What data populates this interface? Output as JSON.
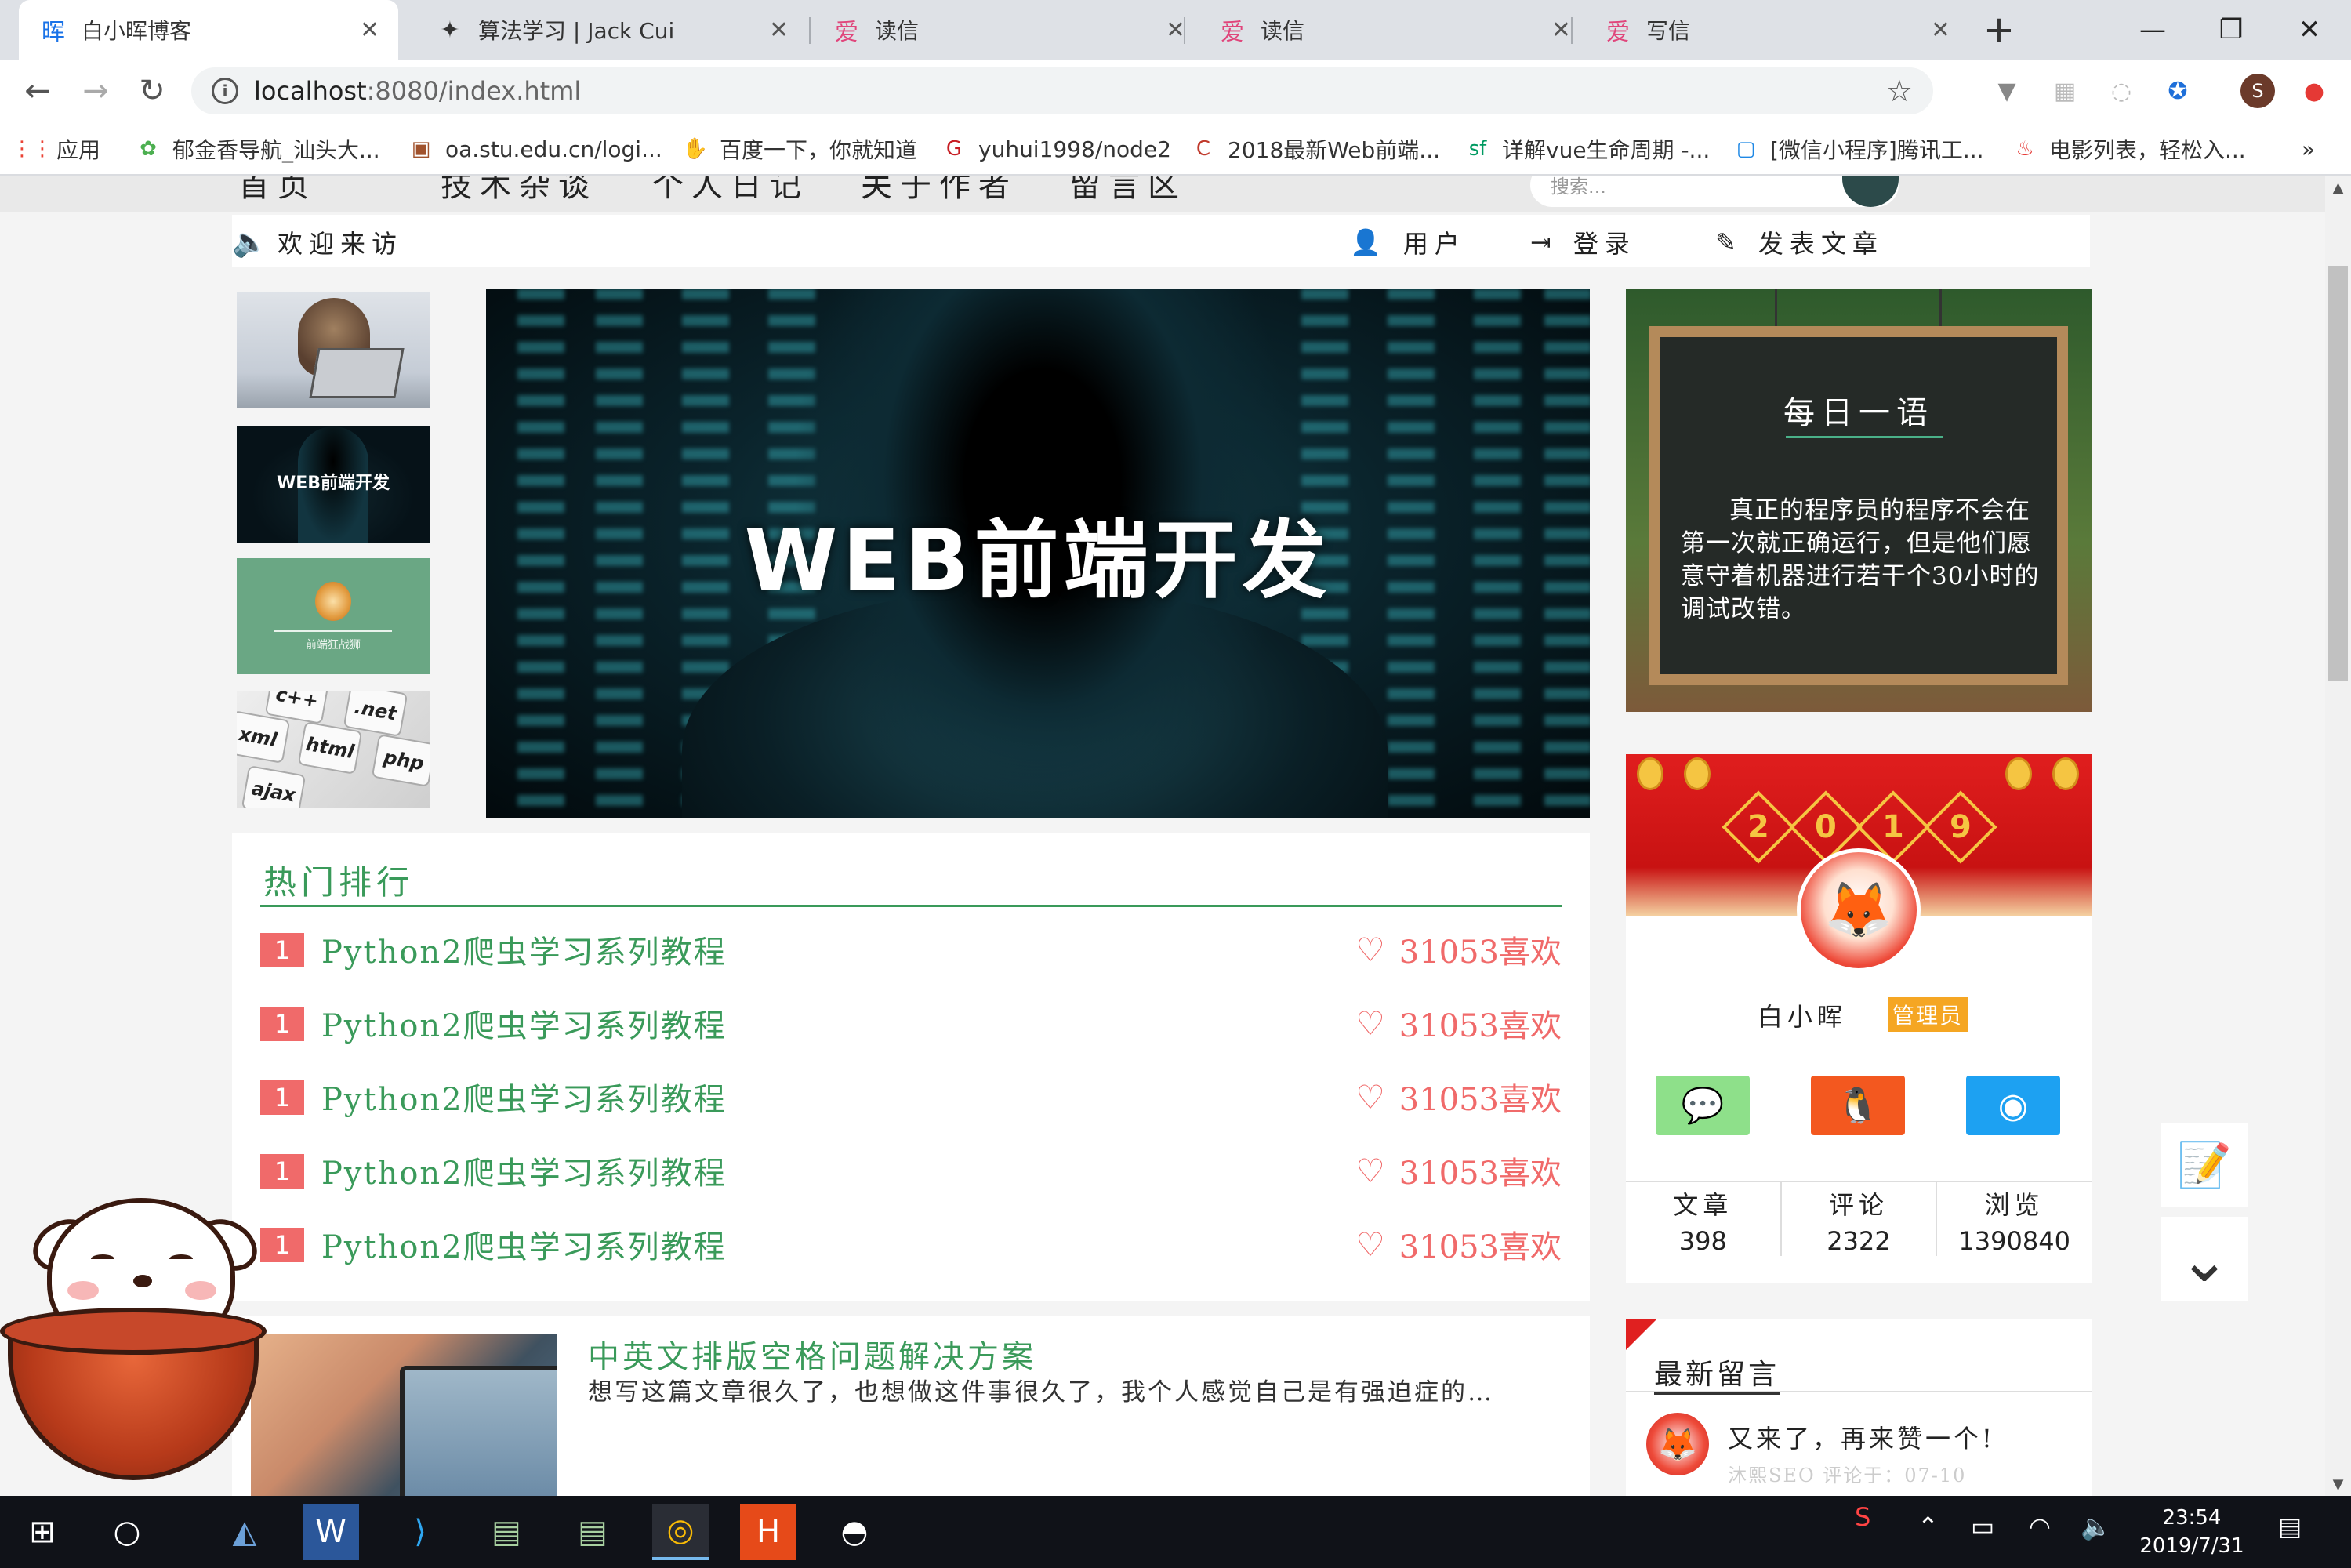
{
  "browser": {
    "tabs": [
      {
        "title": "白小晖博客",
        "favicon": "晖",
        "favicon_color": "#1a73e8",
        "active": true
      },
      {
        "title": "算法学习 | Jack Cui",
        "favicon": "✦",
        "favicon_color": "#333333",
        "active": false
      },
      {
        "title": "读信",
        "favicon": "爱",
        "favicon_color": "#e0457b",
        "active": false
      },
      {
        "title": "读信",
        "favicon": "爱",
        "favicon_color": "#e0457b",
        "active": false
      },
      {
        "title": "写信",
        "favicon": "爱",
        "favicon_color": "#e0457b",
        "active": false
      }
    ],
    "tab_close_glyph": "✕",
    "new_tab_glyph": "+",
    "window_controls": {
      "minimize": "—",
      "maximize": "❐",
      "close": "✕"
    },
    "nav": {
      "back": "←",
      "forward": "→",
      "reload": "↻"
    },
    "address": {
      "host": "localhost",
      "path": ":8080/index.html",
      "info_glyph": "i",
      "star_glyph": "☆"
    },
    "profile_initial": "S",
    "bookmarks": [
      {
        "label": "应用",
        "icon": "apps-grid-icon",
        "glyph": "⋮⋮",
        "color": "#ea4335"
      },
      {
        "label": "郁金香导航_汕头大...",
        "icon": "tulip-icon",
        "glyph": "✿",
        "color": "#4caf50"
      },
      {
        "label": "oa.stu.edu.cn/logi...",
        "icon": "page-icon",
        "glyph": "▣",
        "color": "#a0522d"
      },
      {
        "label": "百度一下，你就知道",
        "icon": "baidu-paw-icon",
        "glyph": "✋",
        "color": "#2f6fe4"
      },
      {
        "label": "yuhui1998/node2",
        "icon": "gitee-icon",
        "glyph": "G",
        "color": "#c71d23"
      },
      {
        "label": "2018最新Web前端...",
        "icon": "csdn-icon",
        "glyph": "C",
        "color": "#c0392b"
      },
      {
        "label": "详解vue生命周期 -...",
        "icon": "segmentfault-icon",
        "glyph": "sf",
        "color": "#009a61"
      },
      {
        "label": "[微信小程序]腾讯工...",
        "icon": "tv-icon",
        "glyph": "▢",
        "color": "#1e88e5"
      },
      {
        "label": "电影列表，轻松入...",
        "icon": "flame-icon",
        "glyph": "♨",
        "color": "#e53935"
      }
    ],
    "bookmarks_overflow": "»"
  },
  "page": {
    "topnav": [
      "首页",
      "技术杂谈",
      "个人日记",
      "关于作者",
      "留言区"
    ],
    "search_placeholder": "搜索...",
    "welcome": "欢迎来访",
    "welcome_icon": "🔈",
    "header_links": [
      {
        "label": "用户",
        "glyph": "👤",
        "icon": "user-icon"
      },
      {
        "label": "登录",
        "glyph": "⇥",
        "icon": "login-icon"
      },
      {
        "label": "发表文章",
        "glyph": "✎",
        "icon": "pencil-icon"
      }
    ],
    "thumb_labels": {
      "web": "WEB前端开发",
      "lion": "前端狂战狮"
    },
    "keys": [
      "c++",
      ".net",
      "xml",
      "html",
      "php",
      "ajax"
    ],
    "banner_title": "WEB前端开发",
    "quote": {
      "title": "每日一语",
      "text": "真正的程序员的程序不会在第一次就正确运行，但是他们愿意守着机器进行若干个30小时的调试改错。"
    },
    "hot": {
      "title": "热门排行",
      "items": [
        {
          "rank": "1",
          "name": "Python2爬虫学习系列教程",
          "likes": "31053喜欢"
        },
        {
          "rank": "1",
          "name": "Python2爬虫学习系列教程",
          "likes": "31053喜欢"
        },
        {
          "rank": "1",
          "name": "Python2爬虫学习系列教程",
          "likes": "31053喜欢"
        },
        {
          "rank": "1",
          "name": "Python2爬虫学习系列教程",
          "likes": "31053喜欢"
        },
        {
          "rank": "1",
          "name": "Python2爬虫学习系列教程",
          "likes": "31053喜欢"
        }
      ],
      "heart_glyph": "♡"
    },
    "article": {
      "title": "中英文排版空格问题解决方案",
      "summary": "想写这篇文章很久了，也想做这件事很久了，我个人感觉自己是有强迫症的…"
    },
    "profile": {
      "banner_digits": [
        "2",
        "0",
        "1",
        "9"
      ],
      "name": "白小晖",
      "badge": "管理员",
      "socials": [
        {
          "icon": "wechat-icon",
          "glyph": "💬",
          "color": "#8ee08a"
        },
        {
          "icon": "qq-icon",
          "glyph": "🐧",
          "color": "#f3581f"
        },
        {
          "icon": "weibo-icon",
          "glyph": "◉",
          "color": "#1da1f2"
        }
      ],
      "stats": [
        {
          "label": "文章",
          "value": "398"
        },
        {
          "label": "评论",
          "value": "2322"
        },
        {
          "label": "浏览",
          "value": "1390840"
        }
      ]
    },
    "comments": {
      "title": "最新留言",
      "items": [
        {
          "text": "又来了，再来赞一个!",
          "meta": "沐熙SEO  评论于：07-10"
        }
      ]
    },
    "side_tools": [
      {
        "icon": "edit-note-icon",
        "glyph": "📝"
      },
      {
        "icon": "chevron-double-down-icon",
        "glyph": "⌄"
      }
    ]
  },
  "taskbar": {
    "clock_time": "23:54",
    "clock_date": "2019/7/31",
    "apps": [
      {
        "icon": "windows-start-icon",
        "glyph": "⊞"
      },
      {
        "icon": "cortana-icon",
        "glyph": "○"
      },
      {
        "icon": "mysql-workbench-icon",
        "glyph": "◭"
      },
      {
        "icon": "word-icon",
        "glyph": "W"
      },
      {
        "icon": "vscode-icon",
        "glyph": "⟩"
      },
      {
        "icon": "terminal-icon",
        "glyph": "▤"
      },
      {
        "icon": "terminal-icon-2",
        "glyph": "▤"
      },
      {
        "icon": "chrome-icon",
        "glyph": "◎"
      },
      {
        "icon": "hbuilder-icon",
        "glyph": "H"
      },
      {
        "icon": "photos-icon",
        "glyph": "◓"
      }
    ]
  }
}
